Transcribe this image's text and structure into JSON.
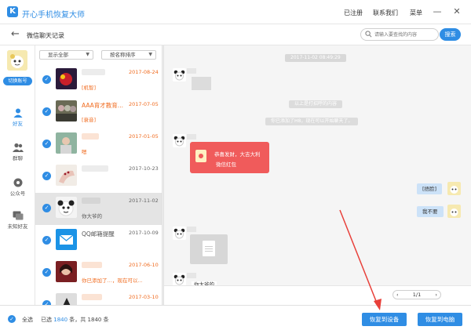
{
  "app": {
    "logo_letter": "K",
    "title": "开心手机恢复大师"
  },
  "topbar": {
    "registered": "已注册",
    "contact_us": "联系我们",
    "menu": "菜单",
    "minimize": "—",
    "close": "✕"
  },
  "subheader": {
    "back": "←",
    "title": "微信聊天记录",
    "search_placeholder": "请输入要查找的内容",
    "search_button": "搜索"
  },
  "leftnav": {
    "switch_account": "切换账号",
    "items": [
      {
        "label": "好友",
        "icon": "person-icon",
        "active": true
      },
      {
        "label": "群聊",
        "icon": "group-icon",
        "active": false
      },
      {
        "label": "公众号",
        "icon": "official-account-icon",
        "active": false
      },
      {
        "label": "未知好友",
        "icon": "unknown-friend-icon",
        "active": false
      }
    ]
  },
  "filters": {
    "show": "显示全部",
    "sort": "按名称排序"
  },
  "contacts": [
    {
      "name": "",
      "message": "[机智]",
      "date": "2017-08-24",
      "highlight": true,
      "avatar": "avatar-red-car"
    },
    {
      "name": "AAA育才教育...",
      "message": "[衰音]",
      "date": "2017-07-05",
      "highlight": true,
      "avatar": "avatar-group-photo"
    },
    {
      "name": "",
      "message": "嗯",
      "date": "2017-01-05",
      "highlight": true,
      "avatar": "avatar-girl"
    },
    {
      "name": "",
      "message": "",
      "date": "2017-10-23",
      "highlight": false,
      "avatar": "avatar-hand"
    },
    {
      "name": "",
      "message": "你大爷的",
      "date": "2017-11-02",
      "highlight": false,
      "avatar": "avatar-panda",
      "selected": true
    },
    {
      "name": "QQ邮箱提醒",
      "message": "",
      "date": "2017-10-09",
      "highlight": false,
      "avatar": "avatar-qqmail"
    },
    {
      "name": "",
      "message": "你已添加了…，现在可以...",
      "date": "2017-06-10",
      "highlight": true,
      "avatar": "avatar-woman"
    },
    {
      "name": "",
      "message": "",
      "date": "2017-03-10",
      "highlight": true,
      "avatar": "avatar-dark"
    }
  ],
  "chat": {
    "timestamp": "2017-11-02 08:49:29",
    "system_1": "以上是打招呼的内容",
    "system_2": "你已添加了H8，现在可以开始聊天了。",
    "redpacket_line1": "恭喜发财，大吉大利",
    "redpacket_line2": "微信红包",
    "right_msg_1": "[捂脸]",
    "right_msg_2": "我不要",
    "partial_msg": "你大爷的",
    "pager": {
      "prev": "‹",
      "page": "1/1",
      "next": "›"
    }
  },
  "footer": {
    "select_all": "全选",
    "selected_prefix": "已选",
    "selected_count": "1840",
    "selected_mid": "条，共",
    "total_count": "1840",
    "unit": "条",
    "restore_device": "恢复到设备",
    "restore_pc": "恢复到电脑"
  },
  "colors": {
    "accent": "#2f8de4",
    "orange": "#f06b1f",
    "red_arrow": "#e8403a",
    "redpacket": "#f05b5b"
  }
}
